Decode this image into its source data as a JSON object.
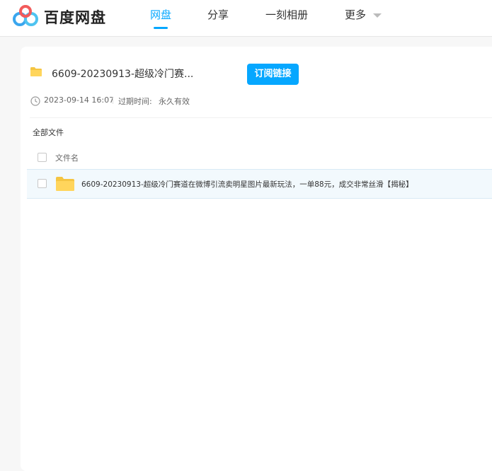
{
  "header": {
    "brand": "百度网盘",
    "nav": [
      {
        "label": "网盘",
        "active": true
      },
      {
        "label": "分享",
        "active": false
      },
      {
        "label": "一刻相册",
        "active": false
      },
      {
        "label": "更多",
        "active": false
      }
    ]
  },
  "share": {
    "title": "6609-20230913-超级冷门赛...",
    "subscribe_label": "订阅链接",
    "date": "2023-09-14 16:07",
    "expire_label": "过期时间:",
    "expire_value": "永久有效"
  },
  "file_list": {
    "breadcrumb": "全部文件",
    "column_name": "文件名",
    "rows": [
      {
        "name": "6609-20230913-超级冷门赛道在微博引流卖明星图片最新玩法，一单88元，成交非常丝滑【揭秘】",
        "icon": "folder-icon"
      }
    ]
  },
  "colors": {
    "accent": "#06a7ff",
    "folder": "#ffd55c",
    "row_highlight": "#f2f9fd"
  }
}
